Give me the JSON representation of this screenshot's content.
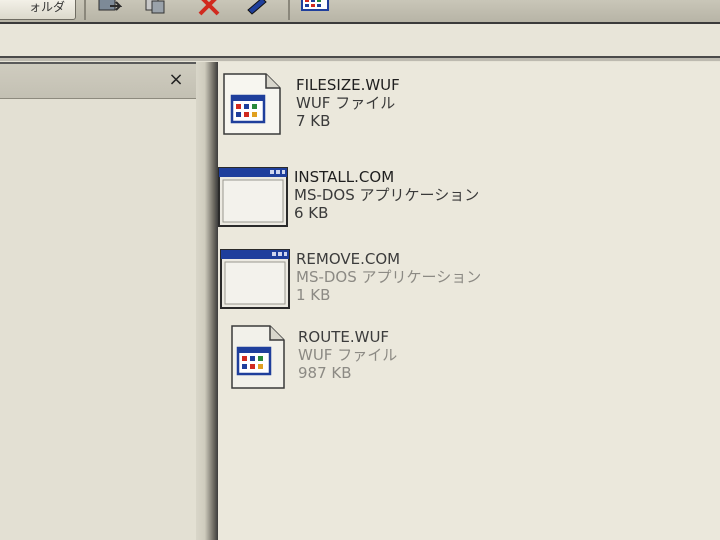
{
  "toolbar": {
    "back_label": "ォルダ",
    "buttons": [
      "move-to-icon",
      "copy-to-icon",
      "delete-icon",
      "undo-icon",
      "views-icon"
    ]
  },
  "left_pane": {
    "close_label": "×"
  },
  "files": [
    {
      "name": "FILESIZE.WUF",
      "type": "WUF ファイル",
      "size": "7 KB",
      "icon": "wuf-file-icon"
    },
    {
      "name": "INSTALL.COM",
      "type": "MS-DOS アプリケーション",
      "size": "6 KB",
      "icon": "ms-dos-app-icon"
    },
    {
      "name": "REMOVE.COM",
      "type": "MS-DOS アプリケーション",
      "size": "1 KB",
      "icon": "ms-dos-app-icon"
    },
    {
      "name": "ROUTE.WUF",
      "type": "WUF ファイル",
      "size": "987 KB",
      "icon": "wuf-file-icon"
    }
  ],
  "colors": {
    "window_blue": "#1f3f9c",
    "background": "#ebe8dc"
  }
}
